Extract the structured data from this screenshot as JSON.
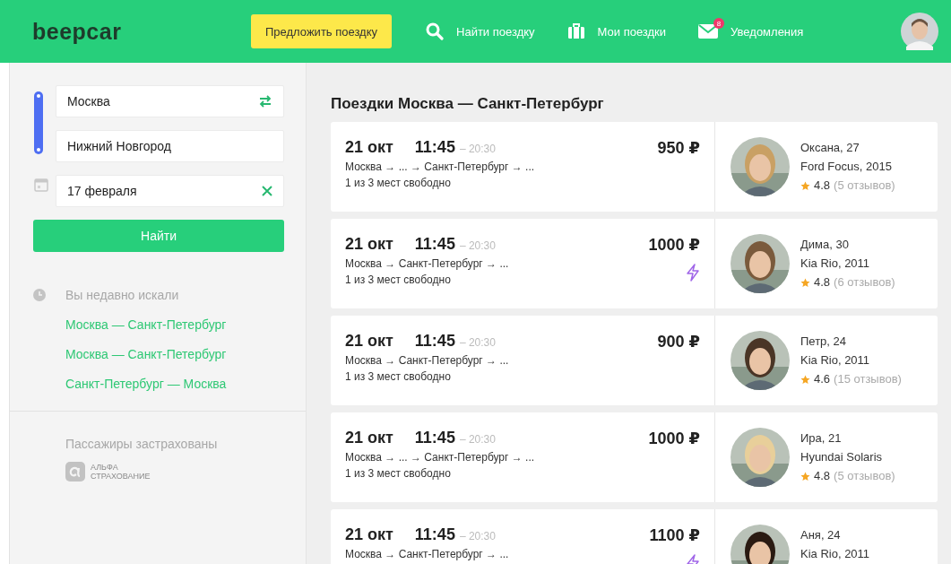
{
  "header": {
    "logo": "beepcar",
    "offer_button": "Предложить поездку",
    "nav": [
      {
        "kind": "search",
        "label": "Найти поездку"
      },
      {
        "kind": "trips",
        "label": "Мои поездки"
      },
      {
        "kind": "notifications",
        "label": "Уведомления",
        "badge": "8"
      }
    ]
  },
  "search": {
    "from": "Москва",
    "to": "Нижний Новгород",
    "date": "17 февраля",
    "submit": "Найти"
  },
  "recent": {
    "title": "Вы недавно искали",
    "items": [
      "Москва — Санкт-Петербург",
      "Москва — Санкт-Петербург",
      "Санкт-Петербург — Москва"
    ]
  },
  "insurance": {
    "text": "Пассажиры застрахованы",
    "logo_line_1": "АЛЬФА",
    "logo_line_2": "СТРАХОВАНИЕ"
  },
  "results": {
    "title": "Поездки Москва — Санкт-Петербург",
    "trips": [
      {
        "date": "21 окт",
        "departure": "11:45",
        "arrival": "– 20:30",
        "route": "Москва → ... → Санкт-Петербург → ...",
        "seats": "1 из 3 мест свободно",
        "price": "950 ₽",
        "instant": false,
        "driver": "Оксана, 27",
        "car": "Ford Focus, 2015",
        "rating": "4.8",
        "reviews": "(5 отзывов)"
      },
      {
        "date": "21 окт",
        "departure": "11:45",
        "arrival": "– 20:30",
        "route": "Москва → Санкт-Петербург → ...",
        "seats": "1 из 3 мест свободно",
        "price": "1000 ₽",
        "instant": true,
        "driver": "Дима, 30",
        "car": "Kia Rio, 2011",
        "rating": "4.8",
        "reviews": "(6 отзывов)"
      },
      {
        "date": "21 окт",
        "departure": "11:45",
        "arrival": "– 20:30",
        "route": "Москва → Санкт-Петербург → ...",
        "seats": "1 из 3 мест свободно",
        "price": "900 ₽",
        "instant": false,
        "driver": "Петр, 24",
        "car": "Kia Rio, 2011",
        "rating": "4.6",
        "reviews": "(15 отзывов)"
      },
      {
        "date": "21 окт",
        "departure": "11:45",
        "arrival": "– 20:30",
        "route": "Москва → ... → Санкт-Петербург → ...",
        "seats": "1 из 3 мест свободно",
        "price": "1000 ₽",
        "instant": false,
        "driver": "Ира, 21",
        "car": "Hyundai Solaris",
        "rating": "4.8",
        "reviews": "(5 отзывов)"
      },
      {
        "date": "21 окт",
        "departure": "11:45",
        "arrival": "– 20:30",
        "route": "Москва → Санкт-Петербург → ...",
        "price": "1100 ₽",
        "instant": true,
        "driver": "Аня, 24",
        "car": "Kia Rio, 2011"
      }
    ]
  }
}
